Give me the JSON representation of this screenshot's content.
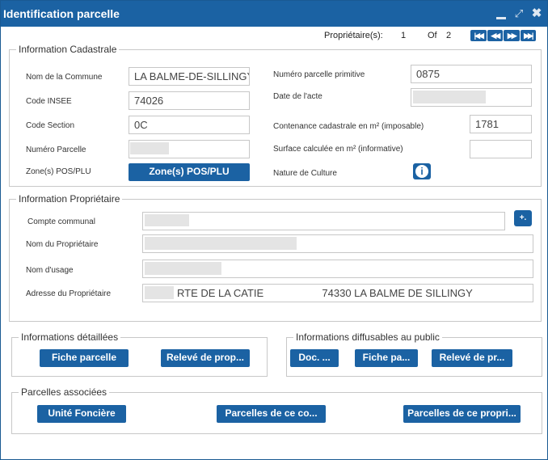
{
  "window": {
    "title": "Identification parcelle"
  },
  "pager": {
    "label": "Propriétaire(s):",
    "current": "1",
    "of_label": "Of",
    "total": "2",
    "first": "|◀◀",
    "prev": "◀◀",
    "next": "▶▶",
    "last": "▶▶|"
  },
  "cadastre": {
    "legend": "Information Cadastrale",
    "commune_label": "Nom de la Commune",
    "commune_value": "LA BALME-DE-SILLINGY",
    "insee_label": "Code INSEE",
    "insee_value": "74026",
    "section_label": "Code Section",
    "section_value": "0C",
    "numero_label": "Numéro Parcelle",
    "numero_value": "",
    "zone_label": "Zone(s) POS/PLU",
    "zone_button": "Zone(s) POS/PLU",
    "primitive_label": "Numéro parcelle primitive",
    "primitive_value": "0875",
    "acte_label": "Date de l'acte",
    "acte_value": "",
    "contenance_label": "Contenance cadastrale en m² (imposable)",
    "contenance_value": "1781",
    "surface_label": "Surface calculée en m² (informative)",
    "surface_value": "",
    "culture_label": "Nature de Culture",
    "culture_icon": "info-icon"
  },
  "proprietaire": {
    "legend": "Information Propriétaire",
    "compte_label": "Compte communal",
    "compte_value": "",
    "nom_label": "Nom du Propriétaire",
    "nom_value": "",
    "usage_label": "Nom d'usage",
    "usage_value": "",
    "adresse_label": "Adresse du Propriétaire",
    "adresse_value": "RTE DE LA CATIE                    74330 LA BALME DE SILLINGY",
    "plus_label": "+."
  },
  "details": {
    "legend": "Informations détaillées",
    "fiche": "Fiche parcelle",
    "releve": "Relevé de prop..."
  },
  "public": {
    "legend": "Informations diffusables au public",
    "doc": "Doc. ...",
    "fiche": "Fiche pa...",
    "releve": "Relevé de pr..."
  },
  "associees": {
    "legend": "Parcelles associées",
    "unite": "Unité Foncière",
    "compte": "Parcelles de ce co...",
    "proprio": "Parcelles de ce propri..."
  }
}
